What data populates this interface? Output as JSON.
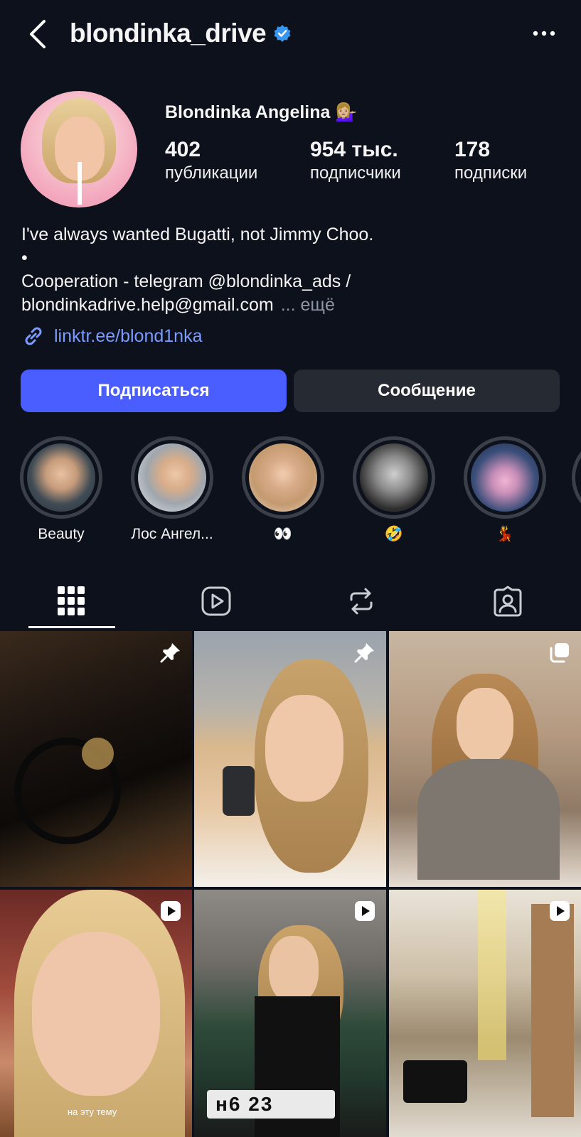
{
  "header": {
    "username": "blondinka_drive",
    "verified": true
  },
  "profile": {
    "display_name": "Blondinka Angelina 💁🏼‍♀️",
    "stats": [
      {
        "value": "402",
        "label": "публикации"
      },
      {
        "value": "954 тыс.",
        "label": "подписчики"
      },
      {
        "value": "178",
        "label": "подписки"
      }
    ],
    "bio_lines": [
      "I've always wanted Bugatti, not Jimmy Choo.",
      "•",
      "Cooperation - telegram @blondinka_ads /",
      "blondinkadrive.help@gmail.com"
    ],
    "bio_more": "... ещё",
    "link": "linktr.ee/blond1nka"
  },
  "actions": {
    "follow_label": "Подписаться",
    "message_label": "Сообщение"
  },
  "highlights": [
    {
      "label": "Beauty"
    },
    {
      "label": "Лос Ангел..."
    },
    {
      "label": "👀"
    },
    {
      "label": "🤣"
    },
    {
      "label": "💃"
    }
  ],
  "tabs": [
    "grid-icon",
    "reels-icon",
    "reposts-icon",
    "tagged-icon"
  ],
  "grid": {
    "captions": {
      "cell_4": "на эту тему"
    },
    "plate_text": "н6  23"
  },
  "colors": {
    "background": "#0c111b",
    "accent": "#4a5dff",
    "link": "#7b9bff",
    "verified": "#3797f0"
  }
}
